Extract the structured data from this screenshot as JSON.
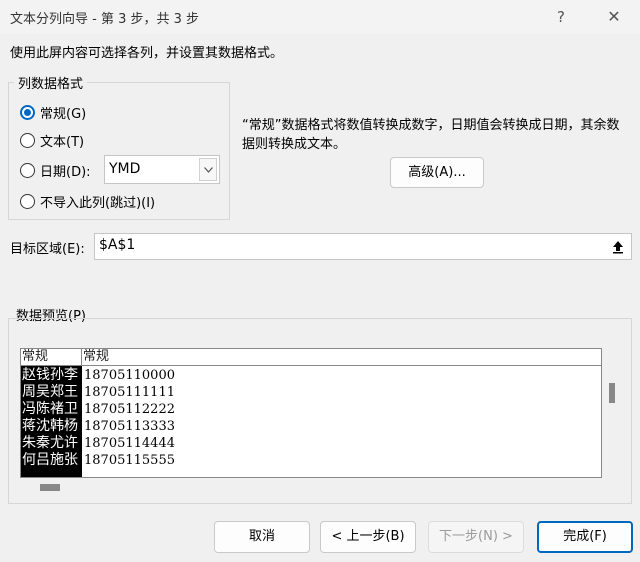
{
  "window": {
    "title": "文本分列向导 - 第 3 步，共 3 步",
    "help_icon": "?",
    "close_icon": "✕"
  },
  "instruction": "使用此屏内容可选择各列，并设置其数据格式。",
  "column_format": {
    "group_label": "列数据格式",
    "options": [
      {
        "label": "常规(G)",
        "selected": true
      },
      {
        "label": "文本(T)",
        "selected": false
      },
      {
        "label": "日期(D):",
        "selected": false
      },
      {
        "label": "不导入此列(跳过)(I)",
        "selected": false
      }
    ],
    "date_value": "YMD",
    "date_dropdown_icon": "chevron-down-icon"
  },
  "description": "“常规”数据格式将数值转换成数字，日期值会转换成日期，其余数据则转换成文本。",
  "advanced_button": "高级(A)...",
  "destination": {
    "label": "目标区域(E):",
    "value": "$A$1",
    "collapse_icon": "collapse-dialog-icon"
  },
  "preview": {
    "label": "数据预览(P)",
    "headers": [
      "常规",
      "常规"
    ],
    "rows": [
      [
        "赵钱孙李",
        "18705110000"
      ],
      [
        "周吴郑王",
        "18705111111"
      ],
      [
        "冯陈褚卫",
        "18705112222"
      ],
      [
        "蒋沈韩杨",
        "18705113333"
      ],
      [
        "朱秦尤许",
        "18705114444"
      ],
      [
        "何吕施张",
        "18705115555"
      ]
    ]
  },
  "buttons": {
    "cancel": "取消",
    "back": "< 上一步(B)",
    "next": "下一步(N) >",
    "finish": "完成(F)"
  },
  "colors": {
    "accent": "#0067c0",
    "selected_column_bg": "#000000"
  }
}
